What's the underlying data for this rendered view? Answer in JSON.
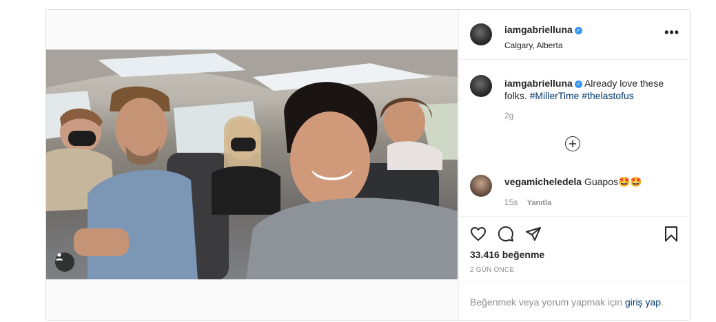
{
  "post": {
    "username": "iamgabrielluna",
    "location": "Calgary, Alberta",
    "caption_text": "Already love these folks.",
    "hashtags": [
      "#MillerTime",
      "#thelastofus"
    ],
    "caption_time": "2g",
    "comment": {
      "username": "vegamicheledela",
      "text": "Guapos",
      "emoji": "🤩🤩",
      "time": "15s",
      "reply_label": "Yanıtla"
    },
    "likes": "33.416 beğenme",
    "date": "2 GÜN ÖNCE",
    "footer": {
      "prefix": "Beğenmek veya yorum yapmak için",
      "link": "giriş yap",
      "suffix": "."
    }
  },
  "icons": {
    "more": "more-options-icon",
    "verified": "verified-badge-icon",
    "add_comment": "plus-circle-icon",
    "like": "heart-icon",
    "comment": "comment-icon",
    "share": "share-icon",
    "save": "bookmark-icon",
    "tagged": "user-tag-icon"
  },
  "colors": {
    "verified": "#3897f0",
    "hashtag": "#00376b",
    "muted": "#8e8e8e"
  }
}
